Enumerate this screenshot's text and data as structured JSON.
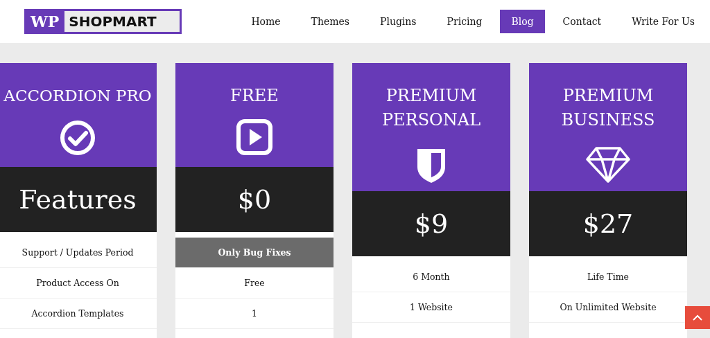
{
  "logo": {
    "part_1": "WP",
    "part_2": "SHOPMART"
  },
  "nav": [
    {
      "label": "Home",
      "selected": false
    },
    {
      "label": "Themes",
      "selected": false
    },
    {
      "label": "Plugins",
      "selected": false
    },
    {
      "label": "Pricing",
      "selected": false
    },
    {
      "label": "Blog",
      "selected": true
    },
    {
      "label": "Contact",
      "selected": false
    },
    {
      "label": "Write For Us",
      "selected": false
    }
  ],
  "plans": [
    {
      "title": "ACCORDION PRO",
      "kind": "check",
      "price": "Features",
      "rows": [
        {
          "text": "Support / Updates Period",
          "highlight": false
        },
        {
          "text": "Product Access On",
          "highlight": false
        },
        {
          "text": "Accordion Templates",
          "highlight": false
        }
      ]
    },
    {
      "title": "FREE",
      "kind": "play",
      "price": "$0",
      "rows": [
        {
          "text": "Only Bug Fixes",
          "highlight": true
        },
        {
          "text": "Free",
          "highlight": false
        },
        {
          "text": "1",
          "highlight": false
        }
      ]
    },
    {
      "title": "PREMIUM PERSONAL",
      "kind": "shield",
      "price": "$9",
      "rows": [
        {
          "text": "6 Month",
          "highlight": false
        },
        {
          "text": "1 Website",
          "highlight": false
        }
      ]
    },
    {
      "title": "PREMIUM BUSINESS",
      "kind": "diamond",
      "price": "$27",
      "rows": [
        {
          "text": "Life Time",
          "highlight": false
        },
        {
          "text": "On Unlimited Website",
          "highlight": false
        }
      ]
    }
  ]
}
